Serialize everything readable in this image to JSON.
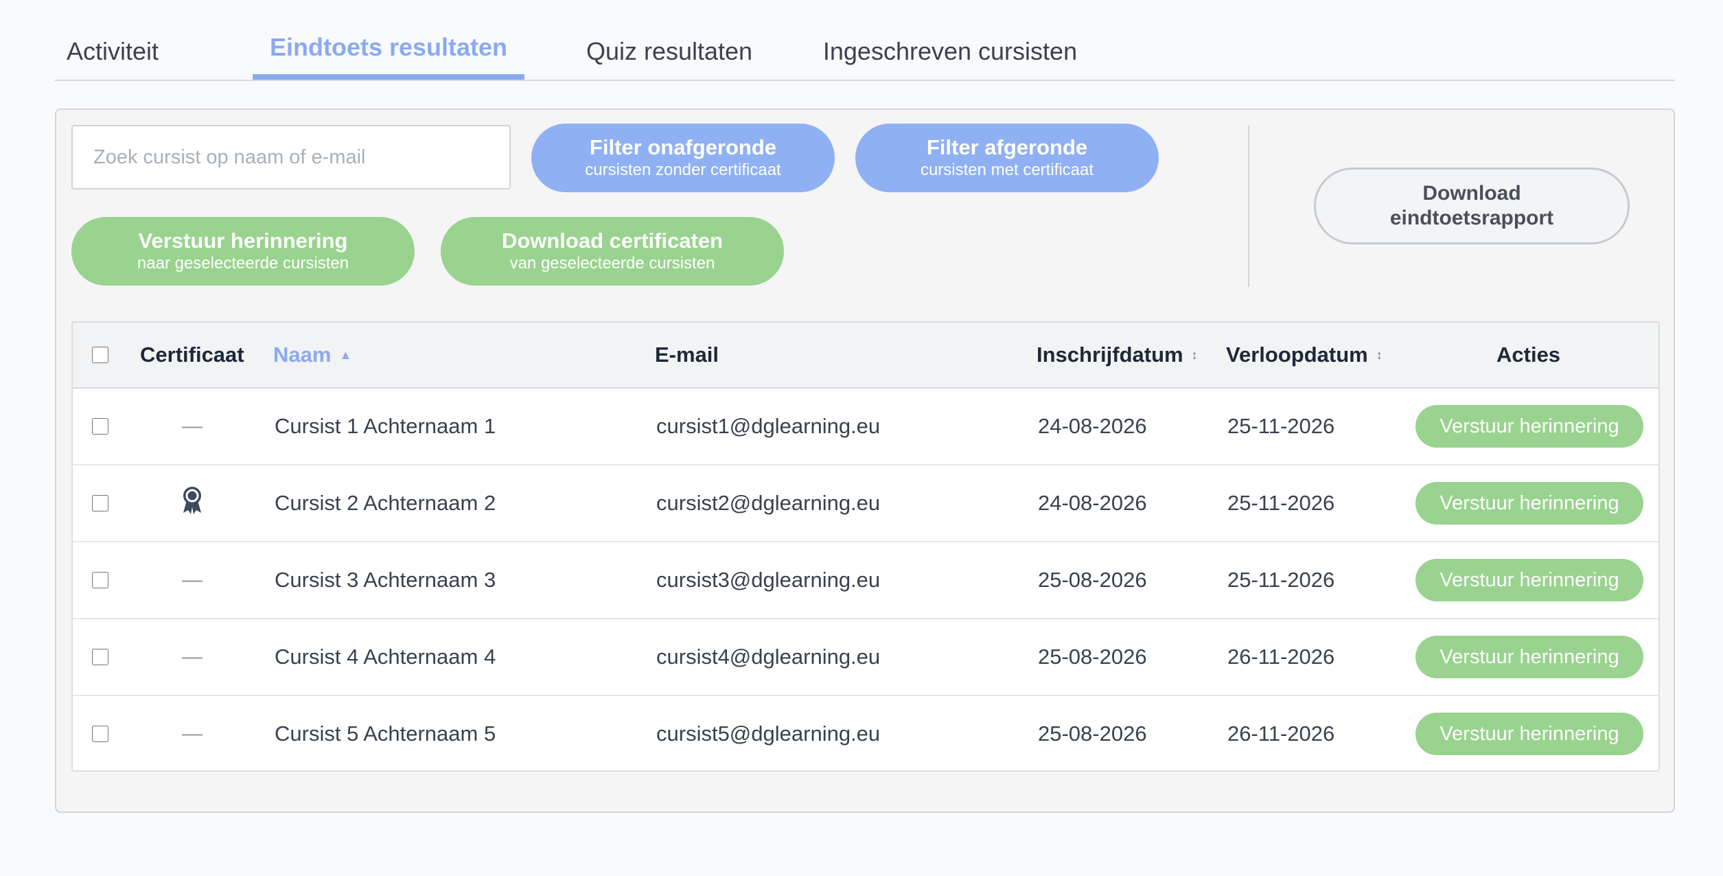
{
  "tabs": [
    {
      "label": "Activiteit",
      "active": false
    },
    {
      "label": "Eindtoets resultaten",
      "active": true
    },
    {
      "label": "Quiz resultaten",
      "active": false
    },
    {
      "label": "Ingeschreven cursisten",
      "active": false
    }
  ],
  "search": {
    "placeholder": "Zoek cursist op naam of e-mail"
  },
  "buttons": {
    "filter_incomplete": {
      "label": "Filter onafgeronde",
      "sub": "cursisten zonder certificaat"
    },
    "filter_complete": {
      "label": "Filter afgeronde",
      "sub": "cursisten met certificaat"
    },
    "send_reminder": {
      "label": "Verstuur herinnering",
      "sub": "naar geselecteerde cursisten"
    },
    "download_certificates": {
      "label": "Download certificaten",
      "sub": "van geselecteerde cursisten"
    },
    "download_report": {
      "label": "Download\neindtoetsrapport"
    }
  },
  "table": {
    "headers": {
      "certificate": "Certificaat",
      "name": "Naam",
      "email": "E-mail",
      "enrollment_date": "Inschrijfdatum",
      "expiry_date": "Verloopdatum",
      "actions": "Acties"
    },
    "sort": {
      "column": "name",
      "direction": "asc"
    },
    "dash": "—",
    "action_label": "Verstuur herinnering",
    "rows": [
      {
        "certificate": false,
        "name": "Cursist 1 Achternaam 1",
        "email": "cursist1@dglearning.eu",
        "enrollment_date": "24-08-2026",
        "expiry_date": "25-11-2026"
      },
      {
        "certificate": true,
        "name": "Cursist 2 Achternaam 2",
        "email": "cursist2@dglearning.eu",
        "enrollment_date": "24-08-2026",
        "expiry_date": "25-11-2026"
      },
      {
        "certificate": false,
        "name": "Cursist 3 Achternaam 3",
        "email": "cursist3@dglearning.eu",
        "enrollment_date": "25-08-2026",
        "expiry_date": "25-11-2026"
      },
      {
        "certificate": false,
        "name": "Cursist 4 Achternaam 4",
        "email": "cursist4@dglearning.eu",
        "enrollment_date": "25-08-2026",
        "expiry_date": "26-11-2026"
      },
      {
        "certificate": false,
        "name": "Cursist 5 Achternaam 5",
        "email": "cursist5@dglearning.eu",
        "enrollment_date": "25-08-2026",
        "expiry_date": "26-11-2026"
      }
    ]
  },
  "colors": {
    "accent_blue": "#8aaaf0",
    "button_blue": "#8fb0f3",
    "button_green": "#99d38f",
    "icon_dark": "#3d4a5c"
  }
}
